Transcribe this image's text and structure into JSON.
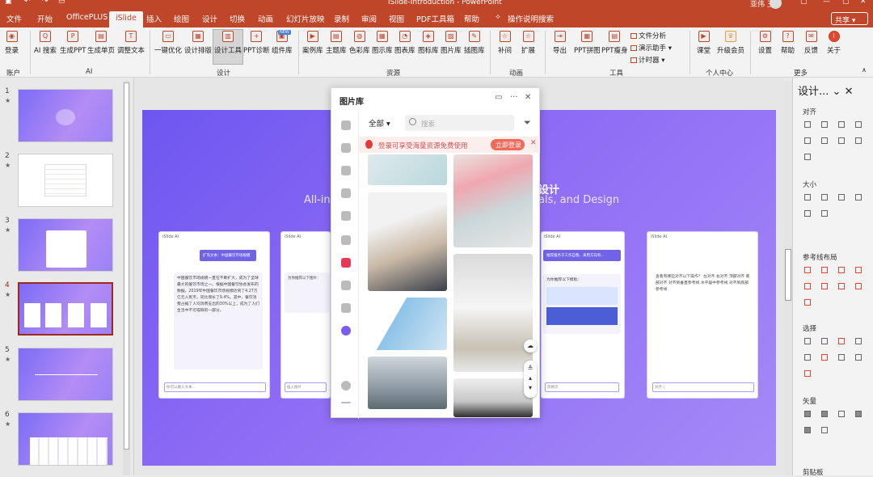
{
  "window": {
    "title": "iSlide-Introduction  -  PowerPoint",
    "user": "亚伟 王",
    "share": "共享"
  },
  "tabs": [
    "文件",
    "开始",
    "OfficePLUS",
    "iSlide",
    "插入",
    "绘图",
    "设计",
    "切换",
    "动画",
    "幻灯片放映",
    "录制",
    "审阅",
    "视图",
    "PDF工具箱",
    "帮助",
    "操作说明搜索"
  ],
  "ribbon": {
    "buttons": [
      "登录",
      "AI 搜索",
      "生成PPT",
      "生成单页",
      "调整文本",
      "一键优化",
      "设计排版",
      "设计工具",
      "PPT诊断",
      "组件库",
      "案例库",
      "主题库",
      "色彩库",
      "图示库",
      "图表库",
      "图标库",
      "图片库",
      "插图库",
      "补间",
      "扩展",
      "导出",
      "PPT拼图",
      "PPT瘦身",
      "课堂",
      "升级会员",
      "设置",
      "帮助",
      "反馈",
      "关于"
    ],
    "small": [
      "文件分析",
      "演示助手",
      "计时器"
    ],
    "groups": [
      "账户",
      "AI",
      "设计",
      "资源",
      "动画",
      "工具",
      "个人中心",
      "更多"
    ],
    "badge": "NEW"
  },
  "slides": [
    {
      "num": "1",
      "star": "★"
    },
    {
      "num": "2",
      "star": "★"
    },
    {
      "num": "3",
      "star": "★"
    },
    {
      "num": "4",
      "star": "★"
    },
    {
      "num": "5",
      "star": "★"
    },
    {
      "num": "6",
      "star": "★"
    }
  ],
  "slide": {
    "title": "设计",
    "sub_left": "All-in-",
    "sub_right": "als, and Design",
    "cards": [
      {
        "head": "iSlide AI",
        "bubble": "扩充文本：中国餐饮市场规模",
        "body": "中国餐饮市场规模一直在不断扩大，成为了全球最大的餐饮市场之一。根据中国餐饮协会发布的数据，2019年中国餐饮市场规模达到了4.27万亿元人民币，同比增长了9.4%。其中，餐饮消费占据了人均消费支出的30%以上，成为了人们生活中不可或缺的一部分。",
        "input": "你可以输入文本..."
      },
      {
        "head": "iSlide AI",
        "bubble": "",
        "body": "为你推荐以下图片：",
        "input": "插入图片"
      },
      {
        "head": "iSlide AI",
        "bubble": "推荐服务于工作自我、采用方向有...",
        "body": "为你推荐以下模板：",
        "input": "风格页"
      },
      {
        "head": "iSlide AI",
        "bubble": "",
        "body": "查看有哪些对齐以下操作？ 左对齐 右对齐 顶部对齐 底部对齐 对齐到垂直参考线 水平居中参考线 对齐到底部参考线",
        "input": "对齐 |"
      }
    ]
  },
  "gallery": {
    "title": "图片库",
    "filter": "全部",
    "search_placeholder": "搜索",
    "promo": "登录可享受海量资源免费使用",
    "promo_btn": "立即登录"
  },
  "panel": {
    "title": "设计...",
    "sections": [
      "对齐",
      "大小",
      "参考线布局",
      "选择",
      "矢量",
      "剪贴板"
    ]
  }
}
